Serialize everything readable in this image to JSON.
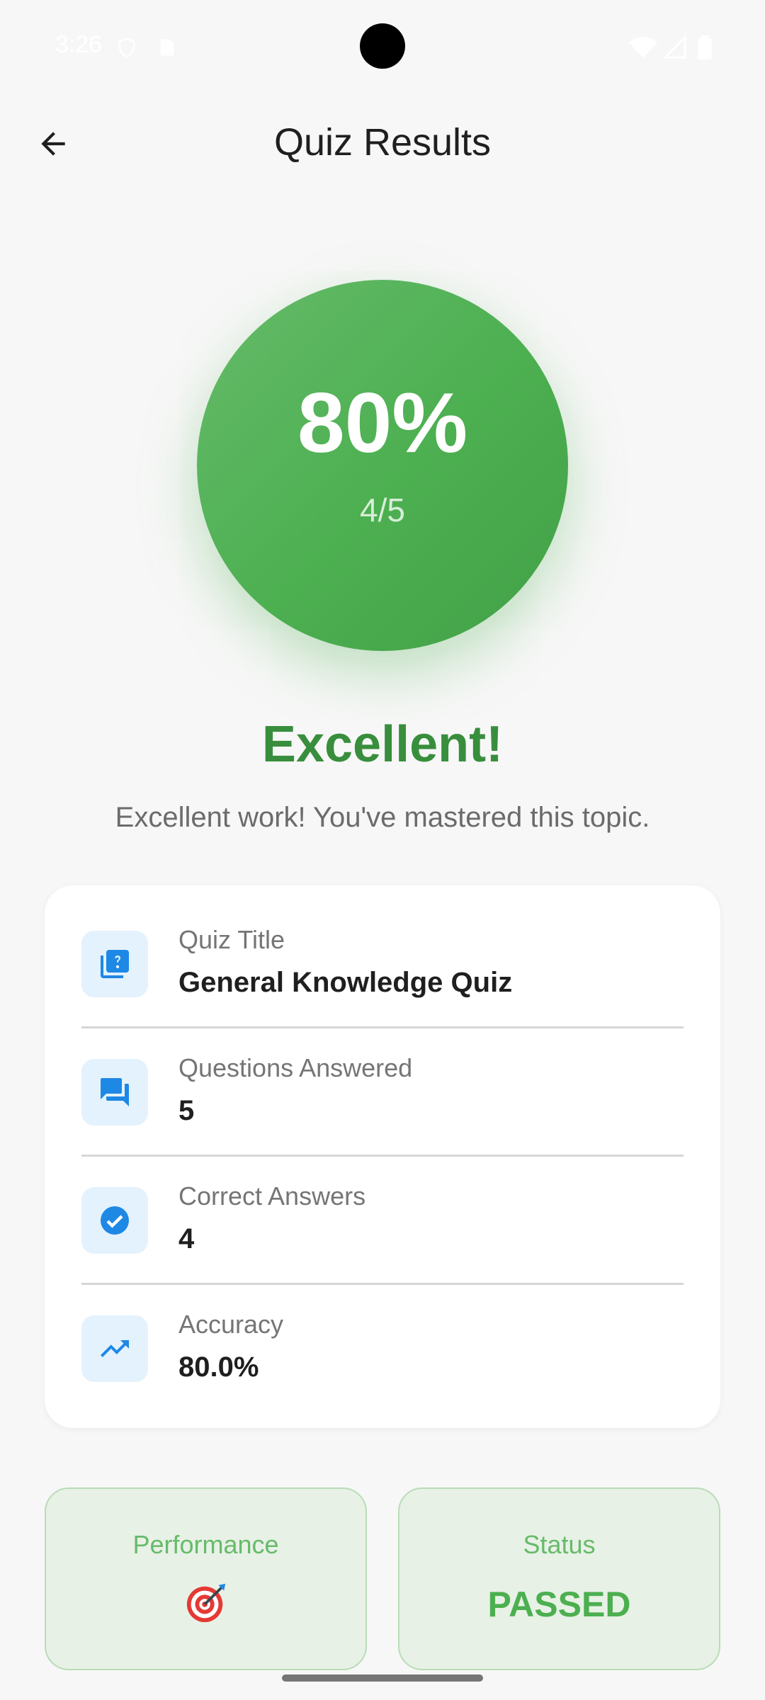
{
  "status_bar": {
    "time": "3:26",
    "icons": [
      "shield-icon",
      "sd-card-icon",
      "wifi-icon",
      "signal-icon",
      "battery-icon"
    ]
  },
  "app_bar": {
    "title": "Quiz Results",
    "back_icon": "arrow-back-icon"
  },
  "score": {
    "percent": "80%",
    "fraction": "4/5",
    "fill": 0.8,
    "color": "#4caf50"
  },
  "result": {
    "heading": "Excellent!",
    "message": "Excellent work! You've mastered this topic."
  },
  "details": [
    {
      "icon": "quiz-icon",
      "label": "Quiz Title",
      "value": "General Knowledge Quiz"
    },
    {
      "icon": "forum-icon",
      "label": "Questions Answered",
      "value": "5"
    },
    {
      "icon": "check-circle-icon",
      "label": "Correct Answers",
      "value": "4"
    },
    {
      "icon": "trending-up-icon",
      "label": "Accuracy",
      "value": "80.0%"
    }
  ],
  "stats": {
    "performance": {
      "label": "Performance",
      "icon": "target-icon"
    },
    "status": {
      "label": "Status",
      "value": "PASSED"
    }
  },
  "colors": {
    "accent_green": "#4caf50",
    "heading_green": "#388e3c",
    "icon_blue": "#1e88e5",
    "icon_bg": "#e3f2fd"
  }
}
